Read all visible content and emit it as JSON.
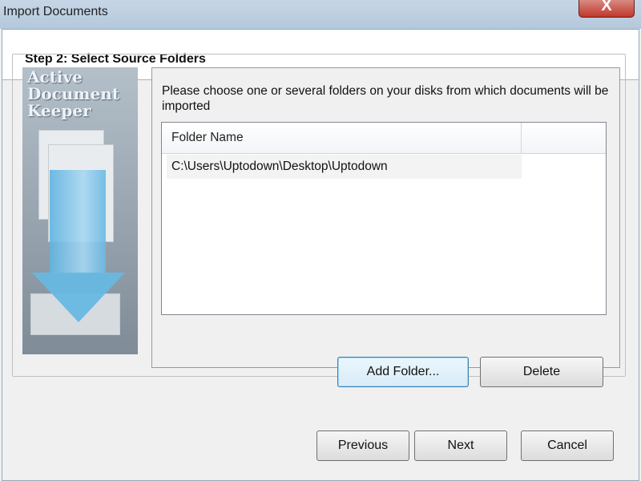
{
  "window": {
    "title": "Import Documents",
    "close_label": "X"
  },
  "header": {
    "step_title": "Step 2: Select Source Folders"
  },
  "side_image": {
    "brand_lines": [
      "Active",
      "Document",
      "Keeper"
    ]
  },
  "panel": {
    "instructions": "Please choose one or several folders on your disks from which documents will be imported"
  },
  "folders": {
    "column_header": "Folder Name",
    "rows": [
      "C:\\Users\\Uptodown\\Desktop\\Uptodown"
    ]
  },
  "buttons": {
    "add_folder": "Add Folder...",
    "delete": "Delete",
    "previous": "Previous",
    "next": "Next",
    "cancel": "Cancel"
  },
  "colors": {
    "focus_border": "#3c7fb1",
    "arrow": "#67b8e2",
    "close": "#c0372a"
  }
}
